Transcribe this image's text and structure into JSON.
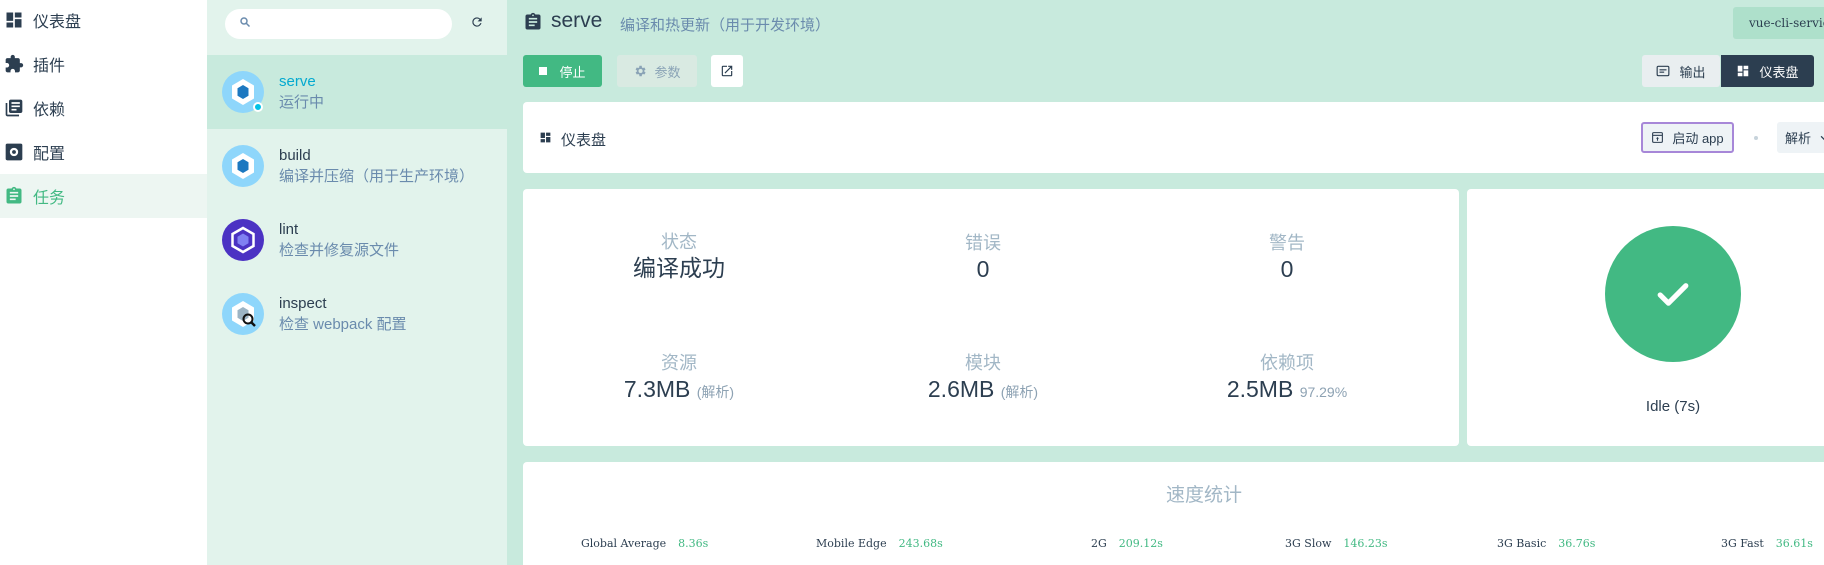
{
  "nav": {
    "items": [
      {
        "label": "仪表盘",
        "icon": "dashboard-icon"
      },
      {
        "label": "插件",
        "icon": "puzzle-icon"
      },
      {
        "label": "依赖",
        "icon": "library-icon"
      },
      {
        "label": "配置",
        "icon": "settings-icon"
      },
      {
        "label": "任务",
        "icon": "assignment-icon"
      }
    ],
    "active": "任务"
  },
  "tasks": {
    "search_placeholder": "",
    "items": [
      {
        "name": "serve",
        "desc": "运行中",
        "icon": "webpack-icon",
        "status": "running"
      },
      {
        "name": "build",
        "desc": "编译并压缩（用于生产环境）",
        "icon": "webpack-icon"
      },
      {
        "name": "lint",
        "desc": "检查并修复源文件",
        "icon": "eslint-icon"
      },
      {
        "name": "inspect",
        "desc": "检查 webpack 配置",
        "icon": "webpack-inspect-icon"
      }
    ]
  },
  "header": {
    "title": "serve",
    "subtitle": "编译和热更新（用于开发环境）",
    "command": "vue-cli-service serve"
  },
  "toolbar": {
    "stop_label": "停止",
    "params_label": "参数",
    "output_label": "输出",
    "dashboard_label": "仪表盘"
  },
  "dashboard": {
    "title": "仪表盘",
    "launch_label": "启动 app",
    "analysis_label": "解析"
  },
  "stats": {
    "status": {
      "label": "状态",
      "value": "编译成功"
    },
    "errors": {
      "label": "错误",
      "value": "0"
    },
    "warnings": {
      "label": "警告",
      "value": "0"
    },
    "assets": {
      "label": "资源",
      "value": "7.3MB",
      "extra": "(解析)"
    },
    "modules": {
      "label": "模块",
      "value": "2.6MB",
      "extra": "(解析)"
    },
    "deps": {
      "label": "依赖项",
      "value": "2.5MB",
      "extra": "97.29%"
    }
  },
  "status_panel": {
    "text": "Idle (7s)"
  },
  "speed": {
    "title": "速度统计",
    "items": [
      {
        "label": "Global Average",
        "value": "8.36s"
      },
      {
        "label": "Mobile Edge",
        "value": "243.68s"
      },
      {
        "label": "2G",
        "value": "209.12s"
      },
      {
        "label": "3G Slow",
        "value": "146.23s"
      },
      {
        "label": "3G Basic",
        "value": "36.76s"
      },
      {
        "label": "3G Fast",
        "value": "36.61s"
      }
    ]
  },
  "colors": {
    "accent": "#42b983",
    "main_bg": "#c8eadd",
    "dark": "#2c3e50",
    "running": "#03c2e6"
  }
}
